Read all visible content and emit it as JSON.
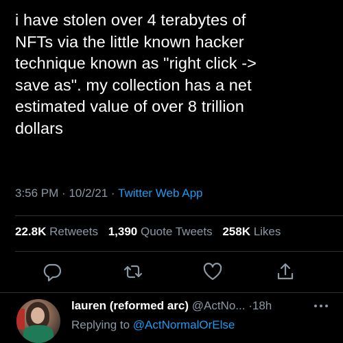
{
  "tweet": {
    "text": "i have stolen over 4 terabytes of\nNFTs via the little known hacker\ntechnique known as \"right click ->\nsave as\". my collection has a net\nestimated value of over 8 trillion\ndollars",
    "time": "3:56 PM",
    "date": "10/2/21",
    "separator": "·",
    "source": "Twitter Web App"
  },
  "stats": {
    "retweets_count": "22.8K",
    "retweets_label": "Retweets",
    "quotes_count": "1,390",
    "quotes_label": "Quote Tweets",
    "likes_count": "258K",
    "likes_label": "Likes"
  },
  "actions": [
    {
      "icon": "reply-icon"
    },
    {
      "icon": "retweet-icon"
    },
    {
      "icon": "like-icon"
    },
    {
      "icon": "share-icon"
    }
  ],
  "reply": {
    "display_name": "lauren (reformed arc)",
    "handle": "@ActNo...",
    "separator": "·",
    "time": "18h",
    "replying_prefix": "Replying to",
    "replying_to": "@ActNormalOrElse"
  },
  "colors": {
    "background": "#000000",
    "text": "#ffffff",
    "secondary": "#8b98a5",
    "accent": "#1d9bf0",
    "divider": "#2f3336"
  }
}
